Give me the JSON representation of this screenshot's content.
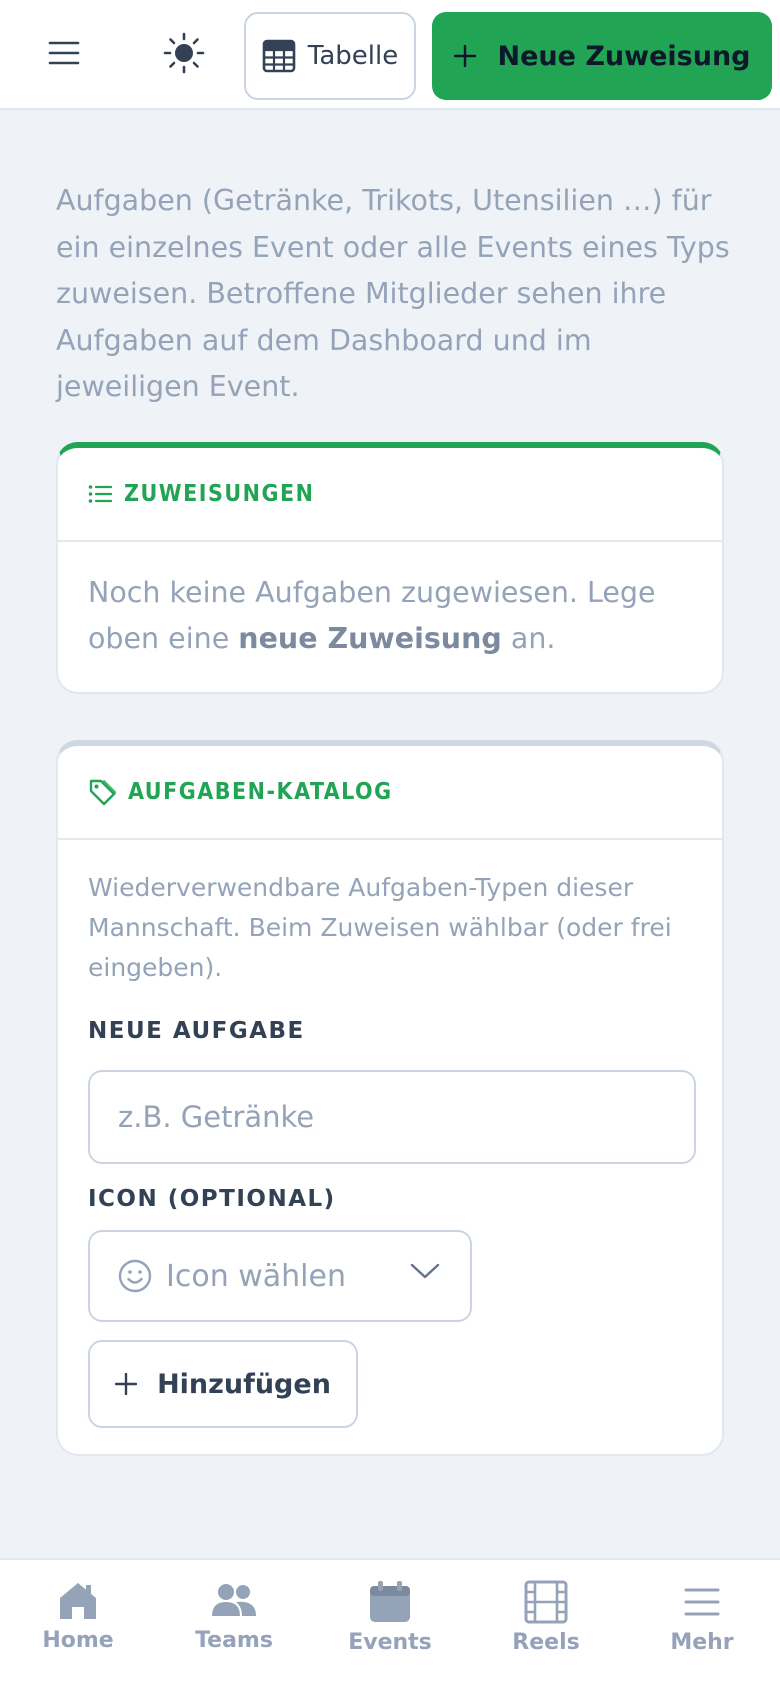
{
  "topbar": {
    "table_label": "Tabelle",
    "new_assignment_label": "Neue Zuweisung"
  },
  "intro": "Aufgaben (Getränke, Trikots, Utensilien …) für ein einzelnes Event oder alle Events eines Typs zuweisen. Betroffene Mitglieder sehen ihre Aufgaben auf dem Dashboard und im jeweiligen Event.",
  "assignments": {
    "title": "ZUWEISUNGEN",
    "empty_prefix": "Noch keine Aufgaben zugewiesen. Lege oben eine ",
    "empty_link": "neue Zuweisung",
    "empty_suffix": " an."
  },
  "catalog": {
    "title": "AUFGABEN-KATALOG",
    "description": "Wiederverwendbare Aufgaben-Typen dieser Mannschaft. Beim Zuweisen wählbar (oder frei eingeben).",
    "new_task_label": "NEUE AUFGABE",
    "new_task_placeholder": "z.B. Getränke",
    "new_task_value": "",
    "icon_label": "ICON (OPTIONAL)",
    "icon_select_text": "Icon wählen",
    "add_button_label": "Hinzufügen"
  },
  "bottom_nav": [
    {
      "label": "Home",
      "icon": "home-icon"
    },
    {
      "label": "Teams",
      "icon": "users-icon"
    },
    {
      "label": "Events",
      "icon": "calendar-icon"
    },
    {
      "label": "Reels",
      "icon": "film-icon"
    },
    {
      "label": "Mehr",
      "icon": "menu-icon"
    }
  ],
  "colors": {
    "accent": "#22a455",
    "muted_text": "#94a3b8",
    "background": "#eff3f8"
  }
}
